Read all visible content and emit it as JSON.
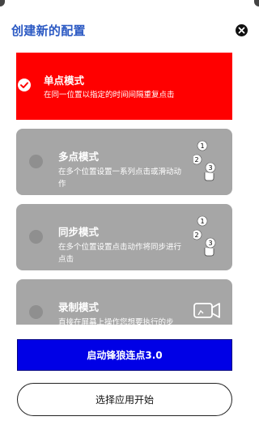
{
  "dialog": {
    "title": "创建新的配置"
  },
  "modes": [
    {
      "title": "单点模式",
      "description": "在同一位置以指定的时间间隔重复点击",
      "selected": true,
      "icon": "check-icon"
    },
    {
      "title": "多点模式",
      "description": "在多个位置设置一系列点击或滑动动作",
      "selected": false,
      "icon": "multi-tap-icon"
    },
    {
      "title": "同步模式",
      "description": "在多个位置设置点击动作将同步进行点击",
      "selected": false,
      "icon": "sync-tap-icon"
    },
    {
      "title": "录制模式",
      "description": "直接在屏幕上操作您想要执行的步骤，目标操作将自动而加",
      "selected": false,
      "icon": "record-icon"
    }
  ],
  "buttons": {
    "start_label": "启动锋狼连点3.0",
    "choose_app_label": "选择应用开始"
  },
  "colors": {
    "accent_title": "#2b59c3",
    "selected_card": "#ff0000",
    "card": "#a6a6a6",
    "primary_button": "#0000e6"
  }
}
